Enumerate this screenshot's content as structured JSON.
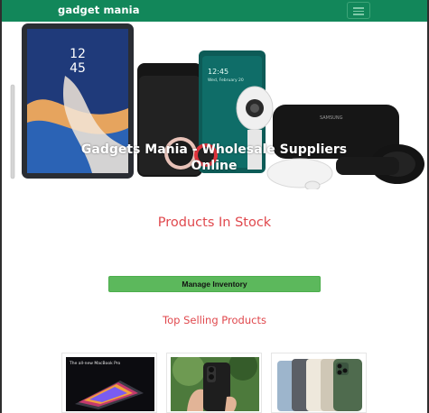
{
  "navbar": {
    "brand": "gadget mania",
    "menu_icon": "hamburger-icon"
  },
  "hero": {
    "title": "Gadgets Mania - Wholesale Suppliers Online",
    "device_time": "12\n45",
    "phone_time": "12:45",
    "phone_date": "Wed, February 20",
    "vr_brand": "SAMSUNG"
  },
  "stock": {
    "title": "Products In Stock"
  },
  "manage": {
    "label": "Manage Inventory"
  },
  "top_selling": {
    "title": "Top Selling Products",
    "products": [
      {
        "caption": "The all-new MacBook Pro"
      },
      {
        "caption": ""
      },
      {
        "caption": ""
      }
    ]
  },
  "colors": {
    "nav": "#12875a",
    "accent": "#e0484d",
    "button": "#5cb85c"
  }
}
